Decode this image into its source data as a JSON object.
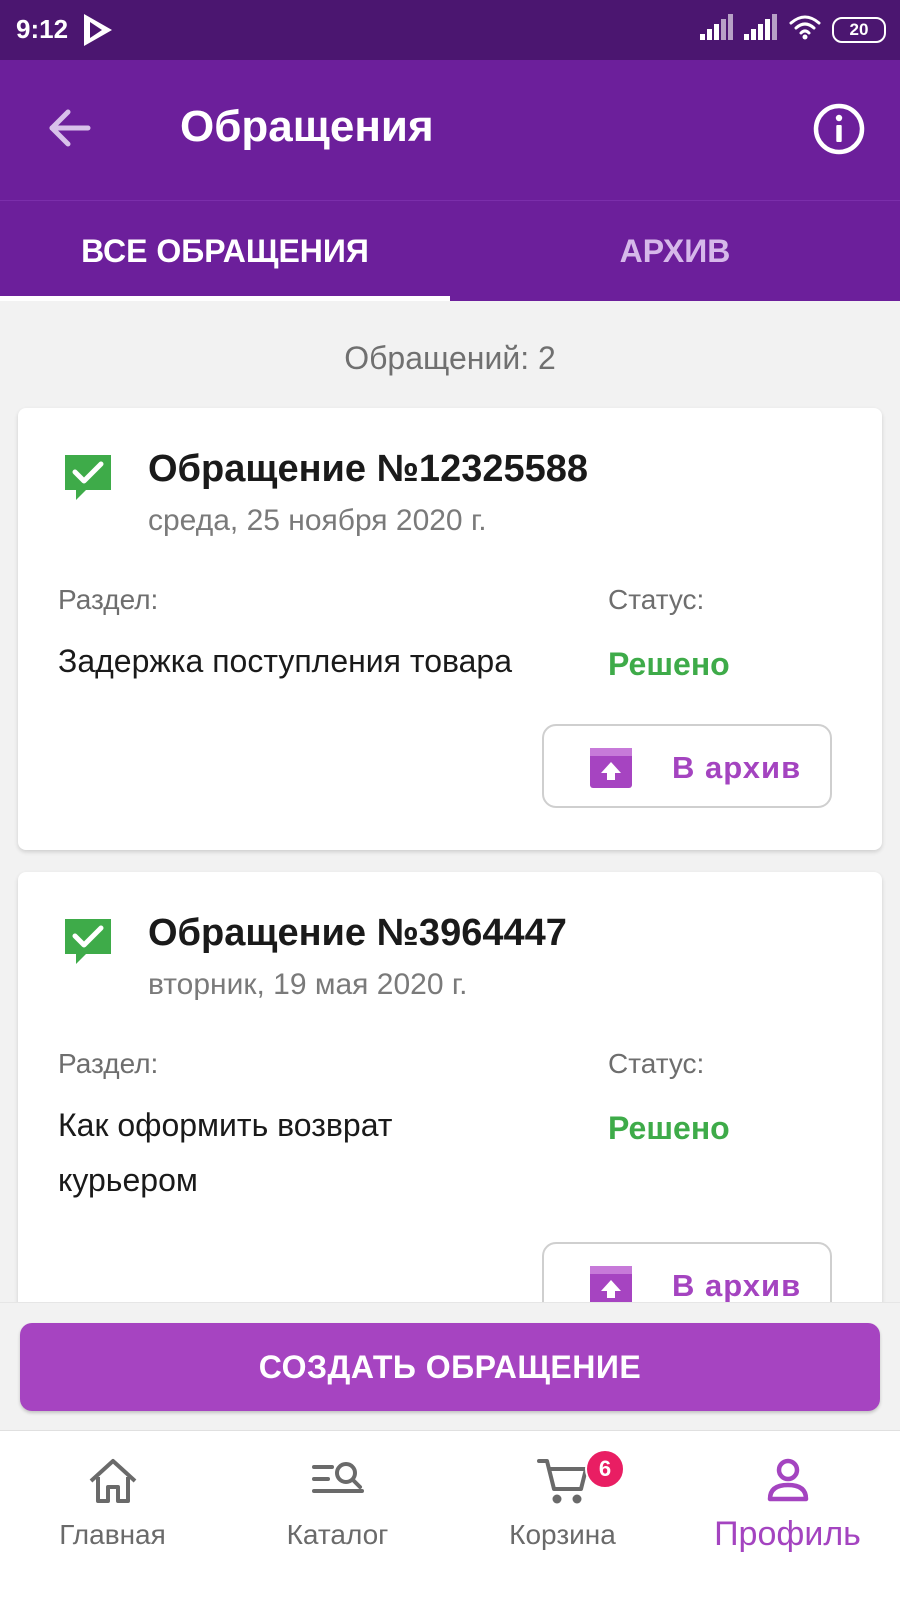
{
  "status_bar": {
    "time": "9:12",
    "battery": "20",
    "icons": [
      "play-logo-icon",
      "signal-icon",
      "signal-icon",
      "wifi-icon",
      "battery-icon"
    ]
  },
  "app_bar": {
    "title": "Обращения",
    "back_icon": "arrow-back-icon",
    "info_icon": "info-icon"
  },
  "tabs": [
    {
      "label": "ВСЕ ОБРАЩЕНИЯ",
      "active": true
    },
    {
      "label": "АРХИВ",
      "active": false
    }
  ],
  "count_text": "Обращений: 2",
  "tickets": [
    {
      "title": "Обращение №12325588",
      "date": "среда, 25 ноября 2020 г.",
      "section_label": "Раздел:",
      "section_value": "Задержка поступления товара",
      "status_label": "Статус:",
      "status_value": "Решено",
      "archive_label": "В архив"
    },
    {
      "title": "Обращение №3964447",
      "date": "вторник, 19 мая 2020 г.",
      "section_label": "Раздел:",
      "section_value": "Как оформить возврат курьером",
      "status_label": "Статус:",
      "status_value": "Решено",
      "archive_label": "В архив"
    }
  ],
  "create_button": "СОЗДАТЬ ОБРАЩЕНИЕ",
  "bottom_nav": [
    {
      "label": "Главная",
      "icon": "home-icon",
      "active": false
    },
    {
      "label": "Каталог",
      "icon": "catalog-search-icon",
      "active": false
    },
    {
      "label": "Корзина",
      "icon": "cart-icon",
      "active": false,
      "badge": "6"
    },
    {
      "label": "Профиль",
      "icon": "profile-icon",
      "active": true
    }
  ],
  "colors": {
    "status_bar": "#4b1670",
    "primary": "#6c1f9b",
    "accent": "#a644c1",
    "status_resolved": "#3eab49",
    "badge": "#e91e63"
  }
}
